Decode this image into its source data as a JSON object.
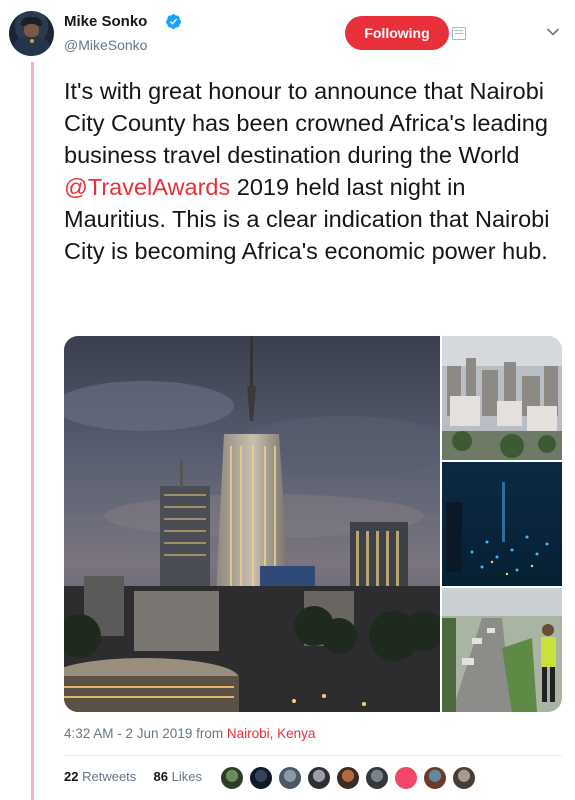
{
  "author": {
    "name": "Mike Sonko",
    "handle": "@MikeSonko",
    "verified": true,
    "follow_label": "Following",
    "accent_color": "#e8303a"
  },
  "tweet": {
    "text_before": "It's with great honour to announce that Nairobi City County has been crowned Africa's leading business travel destination during the World ",
    "mention": "@TravelAwards",
    "text_after": " 2019 held last night in Mauritius. This is a clear indication that Nairobi City is becoming Africa's economic power hub."
  },
  "media": {
    "images": [
      "nairobi-skyline-dusk",
      "nairobi-city-aerial",
      "nairobi-night-lights",
      "nairobi-road-worker"
    ]
  },
  "meta": {
    "timestamp": "4:32 AM - 2 Jun 2019",
    "from_label": "from",
    "location": "Nairobi, Kenya"
  },
  "stats": {
    "retweets_count": "22",
    "retweets_label": "Retweets",
    "likes_count": "86",
    "likes_label": "Likes"
  },
  "icons": {
    "verified": "verified-badge-icon",
    "card": "card-icon",
    "menu": "chevron-down-icon"
  }
}
